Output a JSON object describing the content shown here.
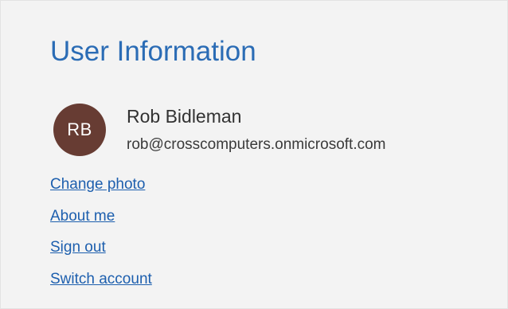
{
  "panel": {
    "title": "User Information"
  },
  "user": {
    "initials": "RB",
    "name": "Rob Bidleman",
    "email": "rob@crosscomputers.onmicrosoft.com"
  },
  "links": [
    "Change photo",
    "About me",
    "Sign out",
    "Switch account"
  ],
  "colors": {
    "panel_background": "#f3f3f3",
    "title": "#2b6cb5",
    "link": "#1d5fae",
    "avatar_background": "#673c33"
  }
}
